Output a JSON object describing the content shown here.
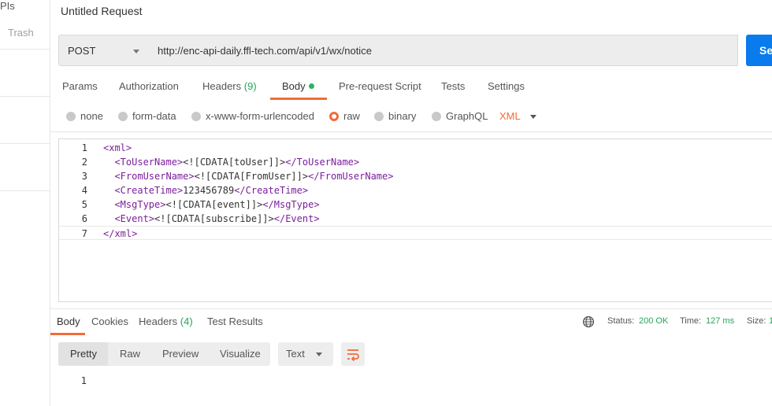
{
  "sidebar": {
    "apis_partial": "PIs",
    "trash_label": "Trash"
  },
  "request": {
    "title": "Untitled Request",
    "method": "POST",
    "url": "http://enc-api-daily.ffl-tech.com/api/v1/wx/notice",
    "send_label": "Send"
  },
  "req_tabs": {
    "params": "Params",
    "authorization": "Authorization",
    "headers": "Headers",
    "headers_count": "(9)",
    "body": "Body",
    "prerequest": "Pre-request Script",
    "tests": "Tests",
    "settings": "Settings"
  },
  "body_types": {
    "none": "none",
    "form_data": "form-data",
    "urlencoded": "x-www-form-urlencoded",
    "raw": "raw",
    "binary": "binary",
    "graphql": "GraphQL",
    "selected": "raw",
    "language": "XML"
  },
  "editor": {
    "lines": [
      {
        "n": "1",
        "indent": "",
        "open": "<xml>",
        "content": "",
        "close": ""
      },
      {
        "n": "2",
        "indent": "  ",
        "open": "<ToUserName>",
        "content": "<![CDATA[toUser]]>",
        "close": "</ToUserName>"
      },
      {
        "n": "3",
        "indent": "  ",
        "open": "<FromUserName>",
        "content": "<![CDATA[FromUser]]>",
        "close": "</FromUserName>"
      },
      {
        "n": "4",
        "indent": "  ",
        "open": "<CreateTime>",
        "content": "123456789",
        "close": "</CreateTime>"
      },
      {
        "n": "5",
        "indent": "  ",
        "open": "<MsgType>",
        "content": "<![CDATA[event]]>",
        "close": "</MsgType>"
      },
      {
        "n": "6",
        "indent": "  ",
        "open": "<Event>",
        "content": "<![CDATA[subscribe]]>",
        "close": "</Event>"
      },
      {
        "n": "7",
        "indent": "",
        "open": "",
        "content": "",
        "close": "</xml>"
      }
    ]
  },
  "response": {
    "tabs": {
      "body": "Body",
      "cookies": "Cookies",
      "headers": "Headers",
      "headers_count": "(4)",
      "test_results": "Test Results"
    },
    "status_label": "Status:",
    "status_value": "200 OK",
    "time_label": "Time:",
    "time_value": "127 ms",
    "size_label": "Size:",
    "size_value": "1",
    "formats": {
      "pretty": "Pretty",
      "raw": "Raw",
      "preview": "Preview",
      "visualize": "Visualize"
    },
    "text_select": "Text",
    "line_number": "1"
  },
  "colors": {
    "accent": "#f26b3a",
    "send_blue": "#097bed",
    "success_green": "#26a55a",
    "xml_tag": "#7a1f9b"
  }
}
